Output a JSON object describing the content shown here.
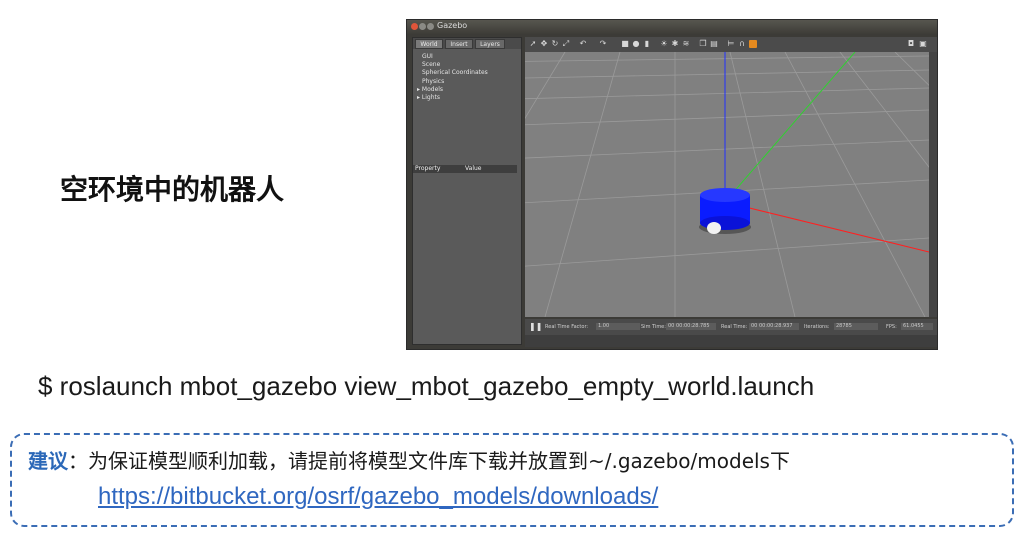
{
  "slide": {
    "heading": "空环境中的机器人",
    "command": "$ roslaunch mbot_gazebo view_mbot_gazebo_empty_world.launch",
    "tip": {
      "label": "建议",
      "text": "：为保证模型顺利加载，请提前将模型文件库下载并放置到~/.gazebo/models下",
      "link": "https://bitbucket.org/osrf/gazebo_models/downloads/"
    }
  },
  "gazebo": {
    "title": "Gazebo",
    "tabs": [
      "World",
      "Insert",
      "Layers"
    ],
    "tree": [
      "GUI",
      "Scene",
      "Spherical Coordinates",
      "Physics",
      "▸ Models",
      "▸ Lights"
    ],
    "property_header": {
      "property": "Property",
      "value": "Value"
    },
    "status": {
      "real_time_factor_label": "Real Time Factor:",
      "real_time_factor": "1.00",
      "sim_time_label": "Sim Time:",
      "sim_time": "00 00:00:28.785",
      "real_time_label": "Real Time:",
      "real_time": "00 00:00:28.937",
      "iterations_label": "Iterations:",
      "iterations": "28785",
      "fps_label": "FPS:",
      "fps": "61.0455"
    },
    "colors": {
      "robot": "#0a1cff",
      "ground": "#808080",
      "z_axis": "#2030ff",
      "x_axis": "#ff2020",
      "y_axis": "#30d030"
    }
  }
}
